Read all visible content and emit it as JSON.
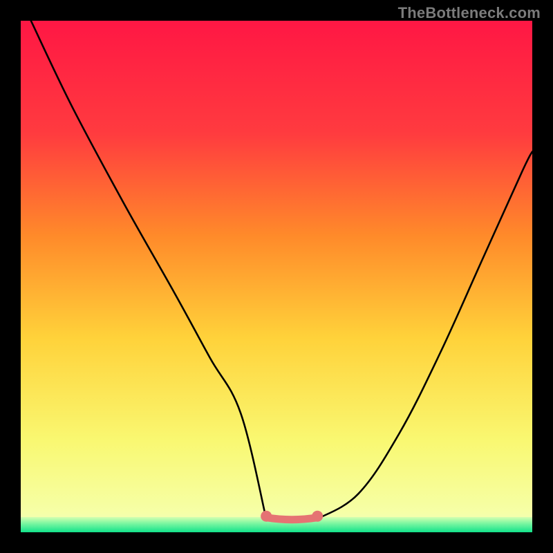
{
  "watermark": "TheBottleneck.com",
  "colors": {
    "frame": "#000000",
    "curve": "#000000",
    "optimal_segment": "#e57373",
    "gradient_stops": [
      "#ff1744",
      "#ff3b3f",
      "#ff8a2a",
      "#ffd23a",
      "#f9f871",
      "#f6ffa6",
      "#eaffc0"
    ],
    "green_band": [
      "#d4ffb0",
      "#7ff7a2",
      "#11e28a"
    ]
  },
  "chart_data": {
    "type": "line",
    "title": "",
    "xlabel": "",
    "ylabel": "",
    "xlim": [
      0,
      100
    ],
    "ylim": [
      0,
      100
    ],
    "series": [
      {
        "name": "curve",
        "x": [
          2,
          10,
          20,
          30,
          37,
          43,
          48,
          52,
          56,
          58,
          66,
          74,
          82,
          90,
          98,
          100
        ],
        "y": [
          100,
          83,
          64,
          46,
          33,
          22,
          12,
          5,
          1,
          0,
          6,
          18,
          34,
          52,
          70,
          74
        ]
      }
    ],
    "optimal_range": {
      "x_start": 48,
      "x_end": 58,
      "y": 1
    },
    "annotations": []
  }
}
